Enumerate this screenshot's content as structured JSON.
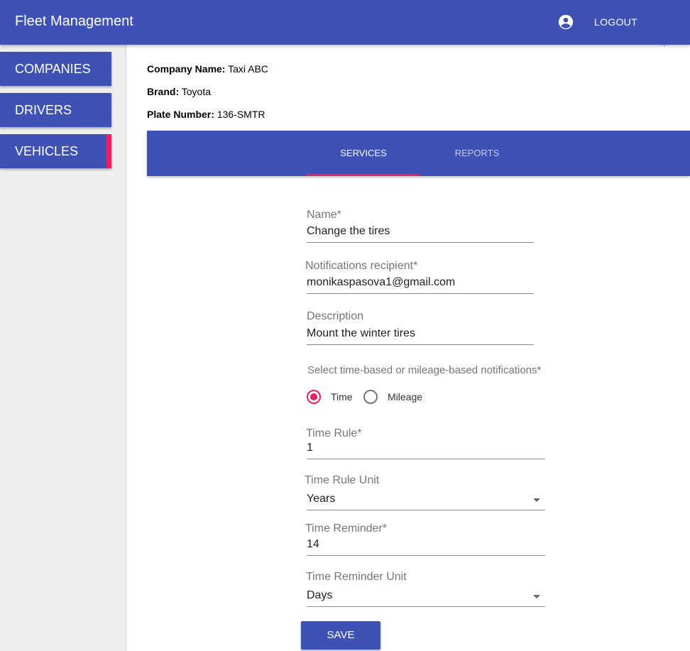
{
  "app": {
    "title": "Fleet Management",
    "logout_label": "LOGOUT",
    "account_icon": "account-circle-icon"
  },
  "sidebar": {
    "items": [
      {
        "label": "COMPANIES",
        "active": false
      },
      {
        "label": "DRIVERS",
        "active": false
      },
      {
        "label": "VEHICLES",
        "active": true
      }
    ]
  },
  "vehicle": {
    "company_label": "Company Name:",
    "company_value": "Taxi ABC",
    "brand_label": "Brand:",
    "brand_value": "Toyota",
    "plate_label": "Plate Number:",
    "plate_value": "136-SMTR"
  },
  "tabs": [
    {
      "label": "SERVICES",
      "active": true
    },
    {
      "label": "REPORTS",
      "active": false
    }
  ],
  "form": {
    "name": {
      "label": "Name*",
      "value": "Change the tires"
    },
    "recipient": {
      "label": "Notifications recipient*",
      "value": "monikaspasova1@gmail.com"
    },
    "description": {
      "label": "Description",
      "value": "Mount the winter tires"
    },
    "notification_type": {
      "label": "Select time-based or mileage-based notifications*",
      "options": [
        {
          "label": "Time",
          "checked": true
        },
        {
          "label": "Mileage",
          "checked": false
        }
      ]
    },
    "time_rule": {
      "label": "Time Rule*",
      "value": "1"
    },
    "time_rule_unit": {
      "label": "Time Rule Unit",
      "value": "Years"
    },
    "time_reminder": {
      "label": "Time Reminder*",
      "value": "14"
    },
    "time_reminder_unit": {
      "label": "Time Reminder Unit",
      "value": "Days"
    },
    "save_label": "SAVE"
  },
  "colors": {
    "primary": "#3f51b5",
    "accent": "#e91e63",
    "sidebar_bg": "#eeeeee"
  }
}
